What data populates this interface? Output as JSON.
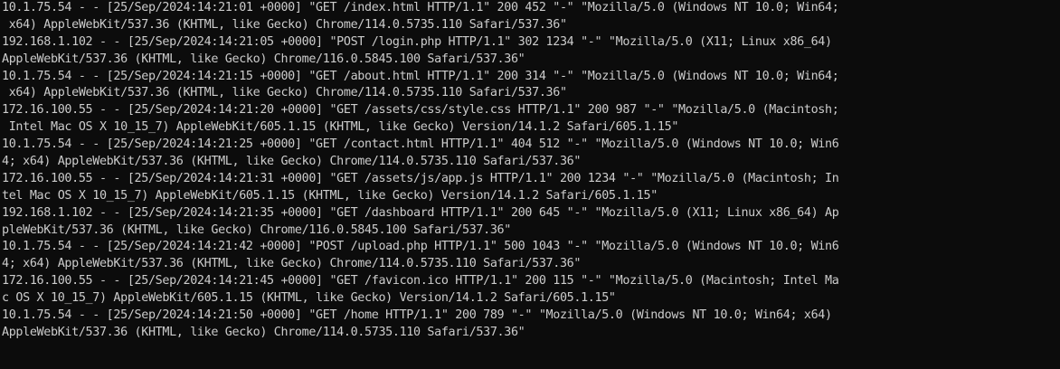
{
  "terminal": {
    "lines": [
      "10.1.75.54 - - [25/Sep/2024:14:21:01 +0000] \"GET /index.html HTTP/1.1\" 200 452 \"-\" \"Mozilla/5.0 (Windows NT 10.0; Win64;",
      " x64) AppleWebKit/537.36 (KHTML, like Gecko) Chrome/114.0.5735.110 Safari/537.36\"",
      "192.168.1.102 - - [25/Sep/2024:14:21:05 +0000] \"POST /login.php HTTP/1.1\" 302 1234 \"-\" \"Mozilla/5.0 (X11; Linux x86_64)",
      "AppleWebKit/537.36 (KHTML, like Gecko) Chrome/116.0.5845.100 Safari/537.36\"",
      "10.1.75.54 - - [25/Sep/2024:14:21:15 +0000] \"GET /about.html HTTP/1.1\" 200 314 \"-\" \"Mozilla/5.0 (Windows NT 10.0; Win64;",
      " x64) AppleWebKit/537.36 (KHTML, like Gecko) Chrome/114.0.5735.110 Safari/537.36\"",
      "172.16.100.55 - - [25/Sep/2024:14:21:20 +0000] \"GET /assets/css/style.css HTTP/1.1\" 200 987 \"-\" \"Mozilla/5.0 (Macintosh;",
      " Intel Mac OS X 10_15_7) AppleWebKit/605.1.15 (KHTML, like Gecko) Version/14.1.2 Safari/605.1.15\"",
      "10.1.75.54 - - [25/Sep/2024:14:21:25 +0000] \"GET /contact.html HTTP/1.1\" 404 512 \"-\" \"Mozilla/5.0 (Windows NT 10.0; Win6",
      "4; x64) AppleWebKit/537.36 (KHTML, like Gecko) Chrome/114.0.5735.110 Safari/537.36\"",
      "172.16.100.55 - - [25/Sep/2024:14:21:31 +0000] \"GET /assets/js/app.js HTTP/1.1\" 200 1234 \"-\" \"Mozilla/5.0 (Macintosh; In",
      "tel Mac OS X 10_15_7) AppleWebKit/605.1.15 (KHTML, like Gecko) Version/14.1.2 Safari/605.1.15\"",
      "192.168.1.102 - - [25/Sep/2024:14:21:35 +0000] \"GET /dashboard HTTP/1.1\" 200 645 \"-\" \"Mozilla/5.0 (X11; Linux x86_64) Ap",
      "pleWebKit/537.36 (KHTML, like Gecko) Chrome/116.0.5845.100 Safari/537.36\"",
      "10.1.75.54 - - [25/Sep/2024:14:21:42 +0000] \"POST /upload.php HTTP/1.1\" 500 1043 \"-\" \"Mozilla/5.0 (Windows NT 10.0; Win6",
      "4; x64) AppleWebKit/537.36 (KHTML, like Gecko) Chrome/114.0.5735.110 Safari/537.36\"",
      "172.16.100.55 - - [25/Sep/2024:14:21:45 +0000] \"GET /favicon.ico HTTP/1.1\" 200 115 \"-\" \"Mozilla/5.0 (Macintosh; Intel Ma",
      "c OS X 10_15_7) AppleWebKit/605.1.15 (KHTML, like Gecko) Version/14.1.2 Safari/605.1.15\"",
      "10.1.75.54 - - [25/Sep/2024:14:21:50 +0000] \"GET /home HTTP/1.1\" 200 789 \"-\" \"Mozilla/5.0 (Windows NT 10.0; Win64; x64)",
      "AppleWebKit/537.36 (KHTML, like Gecko) Chrome/114.0.5735.110 Safari/537.36\""
    ],
    "colors": {
      "background": "#0c0c0c",
      "foreground": "#cccccc"
    }
  }
}
